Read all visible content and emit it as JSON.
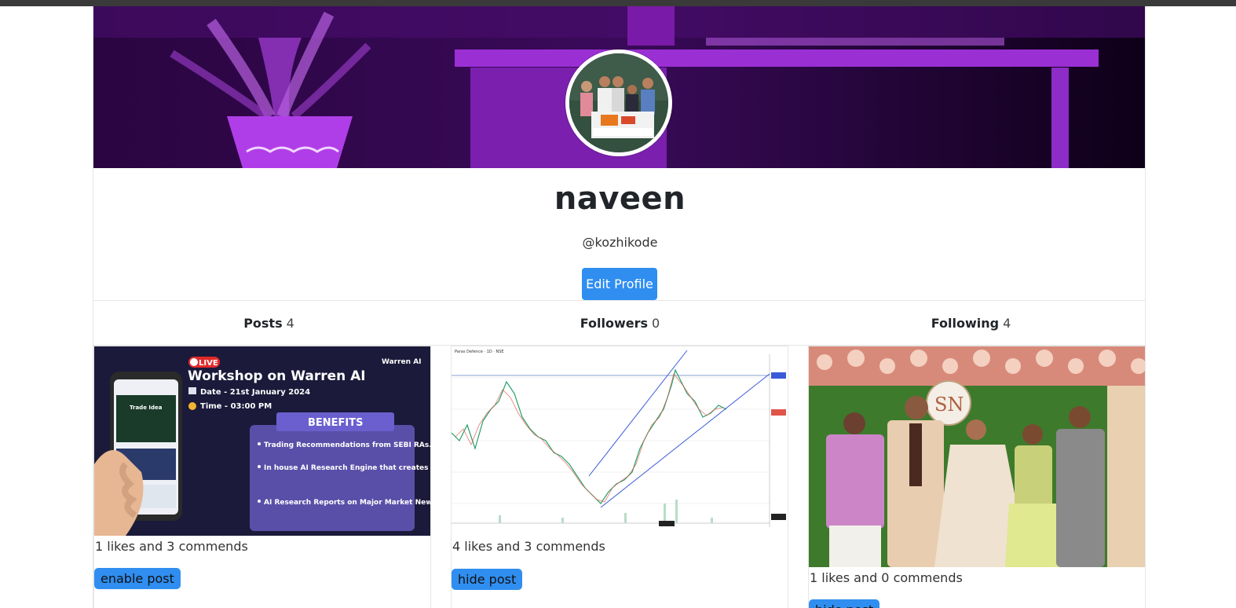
{
  "profile": {
    "username": "naveen",
    "handle": "@kozhikode",
    "edit_label": "Edit Profile"
  },
  "stats": {
    "posts_label": "Posts",
    "posts_count": "4",
    "followers_label": "Followers",
    "followers_count": "0",
    "following_label": "Following",
    "following_count": "4"
  },
  "posts": [
    {
      "meta": "1 likes and 3 commends",
      "action": "enable post",
      "image": {
        "badge": "LIVE",
        "brand": "Warren AI",
        "title": "Workshop on Warren AI",
        "date": "Date - 21st January 2024",
        "time": "Time - 03:00 PM",
        "benefits_title": "BENEFITS",
        "benefits": [
          "Trading Recommendations from SEBI RAs.",
          "In house AI Research Engine that creates reports on Major Economic Events affecting markets.",
          "AI Research Reports on Major Market News."
        ],
        "phone_label": "Trade Idea"
      }
    },
    {
      "meta": "4 likes and 3 commends",
      "action": "hide post",
      "image": {
        "chart_header": "Paras Defence · 1D · NSE"
      }
    },
    {
      "meta": "1 likes and 0 commends",
      "action": "hide post",
      "image": {
        "monogram": "SN"
      }
    }
  ],
  "colors": {
    "accent": "#2f8ef0",
    "cover_purple": "#8a1fc4",
    "benefit_panel": "#5a4fa8"
  }
}
